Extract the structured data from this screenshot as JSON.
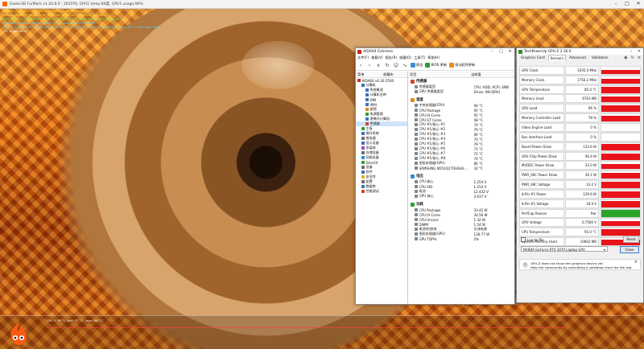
{
  "furmark": {
    "title": "Geeks3D FurMark v1.20.8.0 - 181FPS, GPU1 temp:86度, GPU1 usage:96%",
    "overlay": [
      {
        "text": "FurMark v1.20.8.0 - Burn-in test, 1920x1080 (0X MSAA)",
        "color": "yellow"
      },
      {
        "text": "Frames:114680 - time:10:38 - FPS:181 (min:163, max:259, avg:180)",
        "color": "yellow"
      },
      {
        "text": "[ GPU-Z ] core: 1035 MHz - mem: 1750 MHz - GPU load: 96 % - GPU temp: 85 °C",
        "color": "green"
      },
      {
        "text": "- OpenGL renderer: GeForce RTX 3070 Laptop GPU/PCIe/SSE2",
        "color": "cyan"
      },
      {
        "text": "- GPU 1 (GeForce RTX 3070 Laptop GPU) - core: 1035MHz, mem: 1750MHz, temp: 85°C, GPU load: 96%",
        "color": "cyan"
      },
      {
        "text": "- F1: toggle help",
        "color": "white"
      }
    ],
    "graph_label": "GPU 1: 85 °C (min: 37 °C - max: 86 °C)"
  },
  "aida": {
    "title": "AIDA64 Extreme",
    "menu": [
      "文件(F)",
      "查看(V)",
      "报告(R)",
      "收藏(O)",
      "工具(T)",
      "帮助(H)"
    ],
    "toolbar": {
      "report": "报告",
      "bios": "BIOS 更新",
      "driver": "驱动程序更新"
    },
    "tree_headers": [
      "菜单",
      "收藏夹"
    ],
    "tree": [
      {
        "label": "AIDA64 v6.30.5500",
        "color": "#c62828",
        "indent": 0
      },
      {
        "label": "计算机",
        "color": "#3c6fb4",
        "indent": 1
      },
      {
        "label": "系统概述",
        "color": "#3c6fb4",
        "indent": 2
      },
      {
        "label": "计算机名称",
        "color": "#3c6fb4",
        "indent": 2
      },
      {
        "label": "DMI",
        "color": "#3c6fb4",
        "indent": 2
      },
      {
        "label": "IPMI",
        "color": "#3c6fb4",
        "indent": 2
      },
      {
        "label": "超频",
        "color": "#e08a1a",
        "indent": 2
      },
      {
        "label": "电源管理",
        "color": "#2e9d3b",
        "indent": 2
      },
      {
        "label": "便携式计算机",
        "color": "#3c6fb4",
        "indent": 2
      },
      {
        "label": "传感器",
        "color": "#d0462c",
        "indent": 2,
        "selected": true
      },
      {
        "label": "主板",
        "color": "#2e9d3b",
        "indent": 1
      },
      {
        "label": "操作系统",
        "color": "#3c6fb4",
        "indent": 1
      },
      {
        "label": "服务器",
        "color": "#6d6d6d",
        "indent": 1
      },
      {
        "label": "显示设备",
        "color": "#3c6fb4",
        "indent": 1
      },
      {
        "label": "多媒体",
        "color": "#9a4fc1",
        "indent": 1
      },
      {
        "label": "存储设备",
        "color": "#6d6d6d",
        "indent": 1
      },
      {
        "label": "网络设备",
        "color": "#2b8fd0",
        "indent": 1
      },
      {
        "label": "DirectX",
        "color": "#2e9d3b",
        "indent": 1
      },
      {
        "label": "设备",
        "color": "#6d6d6d",
        "indent": 1
      },
      {
        "label": "软件",
        "color": "#3c6fb4",
        "indent": 1
      },
      {
        "label": "安全性",
        "color": "#e0b21a",
        "indent": 1
      },
      {
        "label": "配置",
        "color": "#6d6d6d",
        "indent": 1
      },
      {
        "label": "数据库",
        "color": "#3c6fb4",
        "indent": 1
      },
      {
        "label": "性能测试",
        "color": "#d0462c",
        "indent": 1
      }
    ],
    "main_headers": [
      "项目",
      "当前值"
    ],
    "sections": [
      {
        "title": "传感器",
        "color": "#d0462c",
        "rows": [
          {
            "k": "传感器类型",
            "v": "CPU, HDD, ACPI, SNB"
          },
          {
            "k": "GPU 传感器类型",
            "v": "Driver  (NV-DRV)"
          }
        ]
      },
      {
        "title": "温度",
        "color": "#e08a1a",
        "rows": [
          {
            "k": "中央处理器(CPU)",
            "v": "94 °C"
          },
          {
            "k": "CPU Package",
            "v": "95 °C"
          },
          {
            "k": "CPU IA Cores",
            "v": "95 °C"
          },
          {
            "k": "CPU GT Cores",
            "v": "68 °C"
          },
          {
            "k": "CPU #1/核心 #1",
            "v": "74 °C"
          },
          {
            "k": "CPU #1/核心 #2",
            "v": "79 °C"
          },
          {
            "k": "CPU #1/核心 #3",
            "v": "96 °C"
          },
          {
            "k": "CPU #1/核心 #4",
            "v": "70 °C"
          },
          {
            "k": "CPU #1/核心 #5",
            "v": "79 °C"
          },
          {
            "k": "CPU #1/核心 #6",
            "v": "71 °C"
          },
          {
            "k": "CPU #1/核心 #7",
            "v": "72 °C"
          },
          {
            "k": "CPU #1/核心 #8",
            "v": "74 °C"
          },
          {
            "k": "图形处理器(GPU)",
            "v": "86 °C"
          },
          {
            "k": "SAMSUNG MZVLQ1T0HALB-...",
            "v": "32 °C"
          }
        ]
      },
      {
        "title": "电压",
        "color": "#2b8fd0",
        "rows": [
          {
            "k": "CPU 核心",
            "v": "1.254 V"
          },
          {
            "k": "CPU VID",
            "v": "1.254 V"
          },
          {
            "k": "电池",
            "v": "12.432 V"
          },
          {
            "k": "GPU 核心",
            "v": "0.637 V"
          }
        ]
      },
      {
        "title": "功耗",
        "color": "#2e9d3b",
        "rows": [
          {
            "k": "CPU Package",
            "v": "33.42 W"
          },
          {
            "k": "CPU IA Cores",
            "v": "30.56 W"
          },
          {
            "k": "CPU Uncore",
            "v": "1.32 W"
          },
          {
            "k": "DIMM",
            "v": "1.54 W"
          },
          {
            "k": "电池充/放电",
            "v": "交流电源"
          },
          {
            "k": "图形处理器(GPU)",
            "v": "136.77 W"
          },
          {
            "k": "GPU TDP%",
            "v": "0%"
          }
        ]
      }
    ]
  },
  "gpuz": {
    "title": "TechPowerUp GPU-Z 2.36.0",
    "tabs": [
      "Graphics Card",
      "Sensors",
      "Advanced",
      "Validation"
    ],
    "active_tab": "Sensors",
    "sensors": [
      {
        "name": "GPU Clock",
        "value": "1035.0 MHz",
        "level": 0.55,
        "color": "#e8141a"
      },
      {
        "name": "Memory Clock",
        "value": "1750.2 MHz",
        "level": 0.6,
        "color": "#e8141a"
      },
      {
        "name": "GPU Temperature",
        "value": "85.0 °C",
        "level": 0.85,
        "color": "#e8141a"
      },
      {
        "name": "Memory Used",
        "value": "6763 MB",
        "level": 0.82,
        "color": "#e8141a"
      },
      {
        "name": "GPU Load",
        "value": "96 %",
        "level": 0.96,
        "color": "#e8141a"
      },
      {
        "name": "Memory Controller Load",
        "value": "78 %",
        "level": 0.78,
        "color": "#e8141a"
      },
      {
        "name": "Video Engine Load",
        "value": "0 %",
        "level": 0.0,
        "color": "#e8141a"
      },
      {
        "name": "Bus Interface Load",
        "value": "0 %",
        "level": 0.0,
        "color": "#e8141a"
      },
      {
        "name": "Board Power Draw",
        "value": "133.6 W",
        "level": 0.9,
        "color": "#e8141a"
      },
      {
        "name": "GPU Chip Power Draw",
        "value": "96.6 W",
        "level": 0.85,
        "color": "#e8141a"
      },
      {
        "name": "MVDDC Power Draw",
        "value": "33.0 W",
        "level": 0.75,
        "color": "#e8141a"
      },
      {
        "name": "PWR_SRC Power Draw",
        "value": "39.1 W",
        "level": 0.8,
        "color": "#e8141a"
      },
      {
        "name": "PWR_SRC Voltage",
        "value": "14.2 V",
        "level": 0.9,
        "color": "#e8141a"
      },
      {
        "name": "8-Pin #1 Power",
        "value": "129.6 W",
        "level": 0.9,
        "color": "#e8141a"
      },
      {
        "name": "8-Pin #1 Voltage",
        "value": "16.9 V",
        "level": 0.9,
        "color": "#e8141a"
      },
      {
        "name": "PerfCap Reason",
        "value": "Pwr",
        "level": 1.0,
        "color": "#2aa52a"
      },
      {
        "name": "GPU Voltage",
        "value": "0.7560 V",
        "level": 0.7,
        "color": "#e8141a"
      },
      {
        "name": "CPU Temperature",
        "value": "95.0 °C",
        "level": 0.9,
        "color": "#e8141a"
      },
      {
        "name": "System Memory Used",
        "value": "10602 MB",
        "level": 0.8,
        "color": "#e8141a"
      }
    ],
    "log_label": "Log to file",
    "reset_label": "Reset",
    "gpu_select": "NVIDIA GeForce RTX 3070 Laptop GPU",
    "close_label": "Close",
    "notice_line1": "GPU-Z does not know this graphics device yet.",
    "notice_line2": "Help the community by submitting a validation from the 4th tab."
  }
}
